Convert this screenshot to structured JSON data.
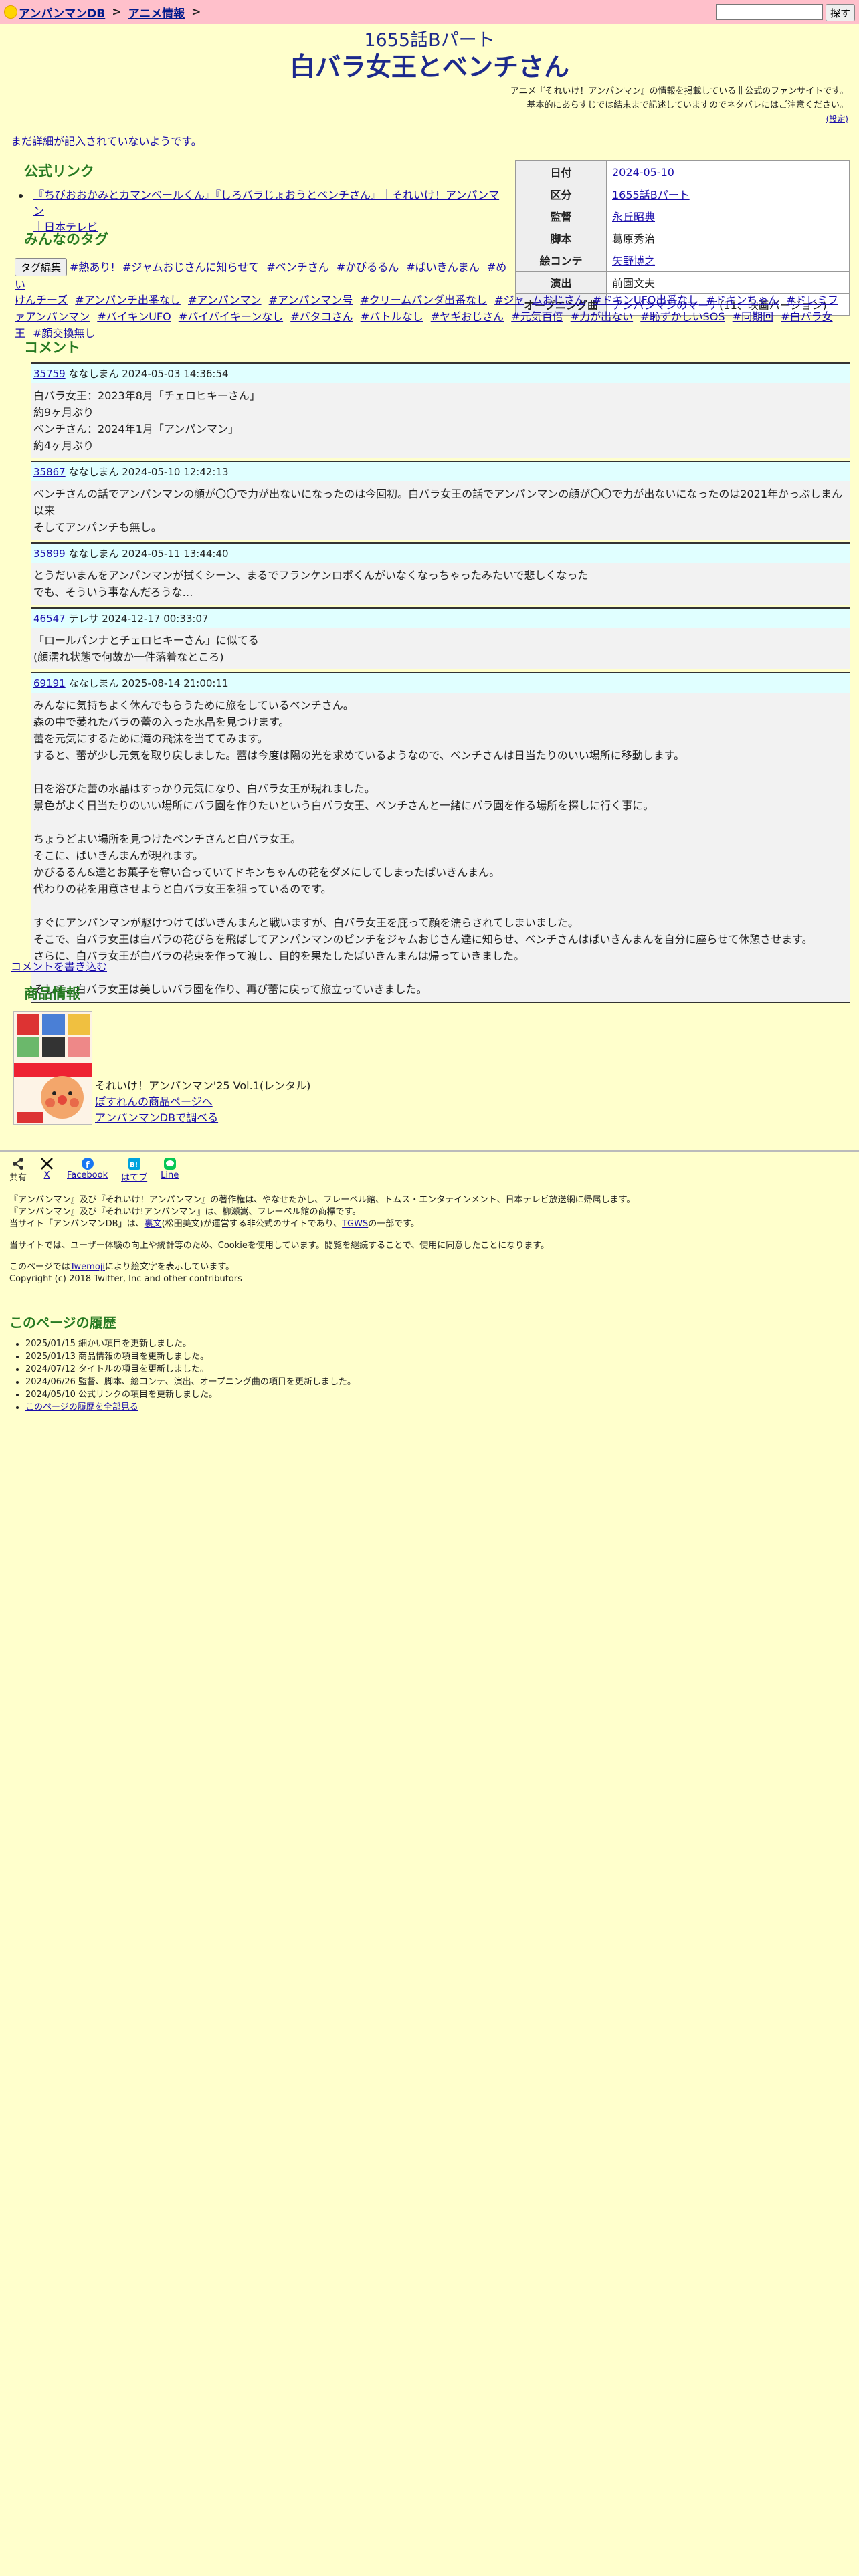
{
  "header": {
    "site_name": "アンパンマンDB",
    "sep1": ">",
    "section": "アニメ情報",
    "sep2": ">",
    "search_button": "探す",
    "search_value": ""
  },
  "episode": {
    "subtitle": "1655話Bパート",
    "title": "白バラ女王とベンチさん"
  },
  "notice": {
    "line1": "アニメ『それいけ！アンパンマン』の情報を掲載している非公式のファンサイトです。",
    "line2": "基本的にあらすじでは結末まで記述していますのでネタバレにはご注意ください。",
    "settings_link": "(設定)"
  },
  "unwritten_link": "まだ詳細が記入されていないようです。",
  "info_table": [
    {
      "key": "日付",
      "value": "2024-05-10",
      "link": true
    },
    {
      "key": "区分",
      "value": "1655話Bパート",
      "link": true
    },
    {
      "key": "監督",
      "value": "永丘昭典",
      "link": true
    },
    {
      "key": "脚本",
      "value": "葛原秀治",
      "link": false
    },
    {
      "key": "絵コンテ",
      "value": "矢野博之",
      "link": true
    },
    {
      "key": "演出",
      "value": "前園文夫",
      "link": false
    },
    {
      "key": "オープニング曲",
      "value": "アンパンマンのマーチ",
      "link": true,
      "suffix": "(11、映画バージョン)"
    }
  ],
  "official": {
    "heading": "公式リンク",
    "link1": "『ちびおおかみとカマンベールくん』『しろバラじょおうとベンチさん』｜それいけ！アンパンマン",
    "link2": "｜日本テレビ"
  },
  "tags_section": {
    "heading": "みんなのタグ",
    "edit_button": "タグ編集",
    "line1": [
      "#熱あり!",
      "#ジャムおじさんに知らせて",
      "#ベンチさん",
      "#かびるるん",
      "#ばいきんまん",
      "#めい"
    ],
    "rest": [
      "けんチーズ",
      "#アンパンチ出番なし",
      "#アンパンマン",
      "#アンパンマン号",
      "#クリームパンダ出番なし",
      "#ジャ",
      "ムおじさん",
      "#ドキンUFO出番なし",
      "#ドキンちゃん",
      "#ドレミファアンパンマン",
      "#バイキンUFO",
      "#バイバイキーンなし",
      "#バタコさん",
      "#バトルなし",
      "#ヤギおじさん",
      "#元気百倍",
      "#力が出ない",
      "#恥ずかしいSOS",
      "#同期回",
      "#白バラ女王",
      "#顔交換無し"
    ]
  },
  "comments_section": {
    "heading": "コメント",
    "items": [
      {
        "id": "35759",
        "meta": "ななしまん 2024-05-03 14:36:54",
        "body": "白バラ女王：2023年8月「チェロヒキーさん」\n約9ヶ月ぶり\nベンチさん：2024年1月「アンパンマン」\n約4ヶ月ぶり"
      },
      {
        "id": "35867",
        "meta": "ななしまん 2024-05-10 12:42:13",
        "body": "ベンチさんの話でアンパンマンの顔が〇〇で力が出ないになったのは今回初。白バラ女王の話でアンパンマンの顔が〇〇で力が出ないになったのは2021年かっぷしまん以来\nそしてアンパンチも無し。"
      },
      {
        "id": "35899",
        "meta": "ななしまん 2024-05-11 13:44:40",
        "body": "とうだいまんをアンパンマンが拭くシーン、まるでフランケンロボくんがいなくなっちゃったみたいで悲しくなった\nでも、そういう事なんだろうな…"
      },
      {
        "id": "46547",
        "meta": "テレサ 2024-12-17 00:33:07",
        "body": "「ロールパンナとチェロヒキーさん」に似てる\n(顔濡れ状態で何故か一件落着なところ)"
      },
      {
        "id": "69191",
        "meta": "ななしまん 2025-08-14 21:00:11",
        "body": "みんなに気持ちよく休んでもらうために旅をしているベンチさん。\n森の中で萎れたバラの蕾の入った水晶を見つけます。\n蕾を元気にするために滝の飛沫を当ててみます。\nすると、蕾が少し元気を取り戻しました。蕾は今度は陽の光を求めているようなので、ベンチさんは日当たりのいい場所に移動します。\n\n日を浴びた蕾の水晶はすっかり元気になり、白バラ女王が現れました。\n景色がよく日当たりのいい場所にバラ園を作りたいという白バラ女王、ベンチさんと一緒にバラ園を作る場所を探しに行く事に。\n\nちょうどよい場所を見つけたベンチさんと白バラ女王。\nそこに、ばいきんまんが現れます。\nかびるるん&達とお菓子を奪い合っていてドキンちゃんの花をダメにしてしまったばいきんまん。\n代わりの花を用意させようと白バラ女王を狙っているのです。\n\nすぐにアンパンマンが駆けつけてばいきんまんと戦いますが、白バラ女王を庇って顔を濡らされてしまいました。\nそこで、白バラ女王は白バラの花びらを飛ばしてアンパンマンのピンチをジャムおじさん達に知らせ、ベンチさんはばいきんまんを自分に座らせて休憩させます。\nさらに、白バラ女王が白バラの花束を作って渡し、目的を果たしたばいきんまんは帰っていきました。\n\nそして、白バラ女王は美しいバラ園を作り、再び蕾に戻って旅立っていきました。"
      }
    ],
    "write_link": "コメントを書き込む"
  },
  "product": {
    "heading": "商品情報",
    "name": "それいけ！アンパンマン'25 Vol.1(レンタル)",
    "link1": "ぽすれんの商品ページへ",
    "link2": "アンパンマンDBで調べる"
  },
  "share": {
    "share_label": "共有",
    "x_label": "X",
    "facebook": "Facebook",
    "hatena": "はてブ",
    "line": "Line"
  },
  "footer": {
    "p1": "『アンパンマン』及び『それいけ！アンパンマン』の著作権は、やなせたかし、フレーベル館、トムス・エンタテインメント、日本テレビ放送網に帰属します。",
    "p1b": "『アンパンマン』及び『それいけ!アンパンマン』は、柳瀬嵩、フレーベル館の商標です。",
    "p1c_pre": "当サイト「アンパンマンDB」は、",
    "p1c_link1": "裏文",
    "p1c_mid": "(松田美文)が運営する非公式のサイトであり、",
    "p1c_link2": "TGWS",
    "p1c_post": "の一部です。",
    "p2": "当サイトでは、ユーザー体験の向上や統計等のため、Cookieを使用しています。閲覧を継続することで、使用に同意したことになります。",
    "p3_pre": "このページでは",
    "p3_link": "Twemoji",
    "p3_post": "により絵文字を表示しています。",
    "p3b": "Copyright (c) 2018 Twitter, Inc and other contributors"
  },
  "history": {
    "heading": "このページの履歴",
    "items": [
      "2025/01/15 細かい項目を更新しました。",
      "2025/01/13 商品情報の項目を更新しました。",
      "2024/07/12 タイトルの項目を更新しました。",
      "2024/06/26 監督、脚本、絵コンテ、演出、オープニング曲の項目を更新しました。",
      "2024/05/10 公式リンクの項目を更新しました。"
    ],
    "all_link": "このページの履歴を全部見る"
  }
}
